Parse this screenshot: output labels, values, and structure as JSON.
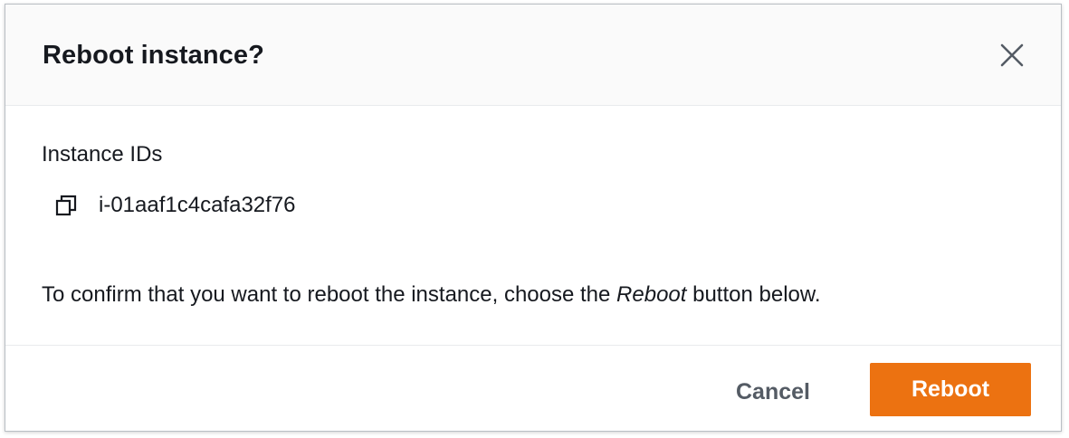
{
  "modal": {
    "title": "Reboot instance?",
    "field_label": "Instance IDs",
    "instance_id": "i-01aaf1c4cafa32f76",
    "confirm_prefix": "To confirm that you want to reboot the instance, choose the ",
    "confirm_emphasis": "Reboot",
    "confirm_suffix": " button below.",
    "close_icon": "close-icon",
    "copy_icon": "copy-icon"
  },
  "footer": {
    "cancel_label": "Cancel",
    "reboot_label": "Reboot"
  },
  "colors": {
    "primary_button": "#ec7211",
    "header_background": "#fafafa",
    "text": "#16191f",
    "secondary_text": "#545b64"
  }
}
